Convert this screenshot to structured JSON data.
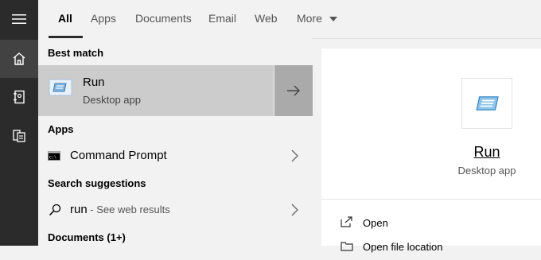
{
  "tabs": [
    {
      "label": "All",
      "active": true
    },
    {
      "label": "Apps"
    },
    {
      "label": "Documents"
    },
    {
      "label": "Email"
    },
    {
      "label": "Web"
    },
    {
      "label": "More"
    }
  ],
  "rail": {
    "items": [
      "hamburger-icon",
      "home-icon",
      "notebook-icon",
      "documents-icon"
    ]
  },
  "sections": {
    "best_match": "Best match",
    "apps": "Apps",
    "search_suggestions": "Search suggestions",
    "documents": "Documents (1+)"
  },
  "best_match": {
    "title": "Run",
    "subtitle": "Desktop app"
  },
  "apps": [
    {
      "label": "Command Prompt"
    }
  ],
  "suggestion": {
    "query": "run",
    "hint": " - See web results"
  },
  "preview": {
    "title": "Run",
    "subtitle": "Desktop app",
    "actions": [
      {
        "label": "Open"
      },
      {
        "label": "Open file location"
      }
    ]
  },
  "colors": {
    "rail": "#2b2b2b",
    "selection": "#cccccc",
    "arrow_bg": "#aaaaaa"
  }
}
